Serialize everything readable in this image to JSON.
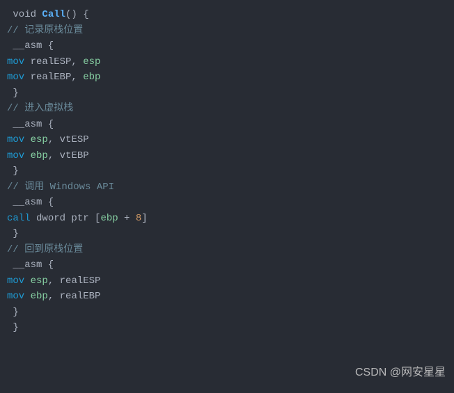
{
  "line1_void": " void ",
  "line1_func": "Call",
  "line1_rest": "() {",
  "line2_comment": "// 记录原栈位置",
  "line3_asm": " __asm {",
  "line4_mov": "mov",
  "line4_var": " realESP, ",
  "line4_reg": "esp",
  "line5_mov": "mov",
  "line5_var": " realEBP, ",
  "line5_reg": "ebp",
  "line6_brace": " }",
  "line7_blank": "",
  "line8_comment": "// 进入虚拟栈",
  "line9_asm": " __asm {",
  "line10_mov": "mov",
  "line10_space": " ",
  "line10_reg": "esp",
  "line10_var": ", vtESP",
  "line11_mov": "mov",
  "line11_space": " ",
  "line11_reg": "ebp",
  "line11_var": ", vtEBP",
  "line12_brace": " }",
  "line13_blank": "",
  "line14_comment": "// 调用 Windows API",
  "line15_asm": " __asm {",
  "line16_call": "call",
  "line16_dword": " dword ptr [",
  "line16_reg": "ebp",
  "line16_plus": " + ",
  "line16_num": "8",
  "line16_close": "]",
  "line17_brace": " }",
  "line18_blank": "",
  "line19_comment": "// 回到原栈位置",
  "line20_asm": " __asm {",
  "line21_mov": "mov",
  "line21_space": " ",
  "line21_reg": "esp",
  "line21_var": ", realESP",
  "line22_mov": "mov",
  "line22_space": " ",
  "line22_reg": "ebp",
  "line22_var": ", realEBP",
  "line23_brace": " }",
  "line24_brace": " }",
  "watermark": "CSDN @网安星星"
}
